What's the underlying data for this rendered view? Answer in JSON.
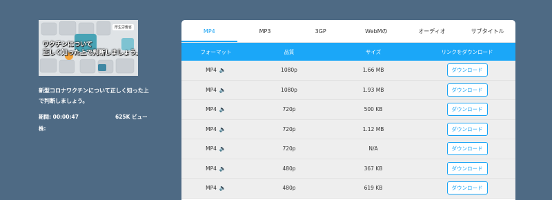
{
  "video": {
    "thumbnail_text_line1": "ワクチンについて",
    "thumbnail_text_line2": "正しく知った上で判断しましょう。",
    "thumbnail_badge": "厚生労働省",
    "title": "新型コロナワクチンについて正しく知った上で判断しましょう。",
    "duration": "期間: 00:00:47",
    "views": "625K ビュー",
    "category": "株:"
  },
  "tabs": [
    {
      "label": "MP4",
      "active": true
    },
    {
      "label": "MP3",
      "active": false
    },
    {
      "label": "3GP",
      "active": false
    },
    {
      "label": "WebMの",
      "active": false
    },
    {
      "label": "オーディオ",
      "active": false
    },
    {
      "label": "サブタイトル",
      "active": false
    }
  ],
  "table": {
    "headers": [
      "フォーマット",
      "品質",
      "サイズ",
      "リンクをダウンロード"
    ],
    "rows": [
      {
        "format": "MP4",
        "quality": "1080p",
        "size": "1.66 MB",
        "action": "ダウンロード"
      },
      {
        "format": "MP4",
        "quality": "1080p",
        "size": "1.93 MB",
        "action": "ダウンロード"
      },
      {
        "format": "MP4",
        "quality": "720p",
        "size": "500 KB",
        "action": "ダウンロード"
      },
      {
        "format": "MP4",
        "quality": "720p",
        "size": "1.12 MB",
        "action": "ダウンロード"
      },
      {
        "format": "MP4",
        "quality": "720p",
        "size": "N/A",
        "action": "ダウンロード"
      },
      {
        "format": "MP4",
        "quality": "480p",
        "size": "367 KB",
        "action": "ダウンロード"
      },
      {
        "format": "MP4",
        "quality": "480p",
        "size": "619 KB",
        "action": "ダウンロード"
      }
    ]
  },
  "icons": {
    "row_audio": "speaker-icon"
  },
  "colors": {
    "background": "#4e6a84",
    "accent": "#1aa4f5",
    "header_bar": "#1ba7f8",
    "row_bg": "#eeeeee"
  }
}
